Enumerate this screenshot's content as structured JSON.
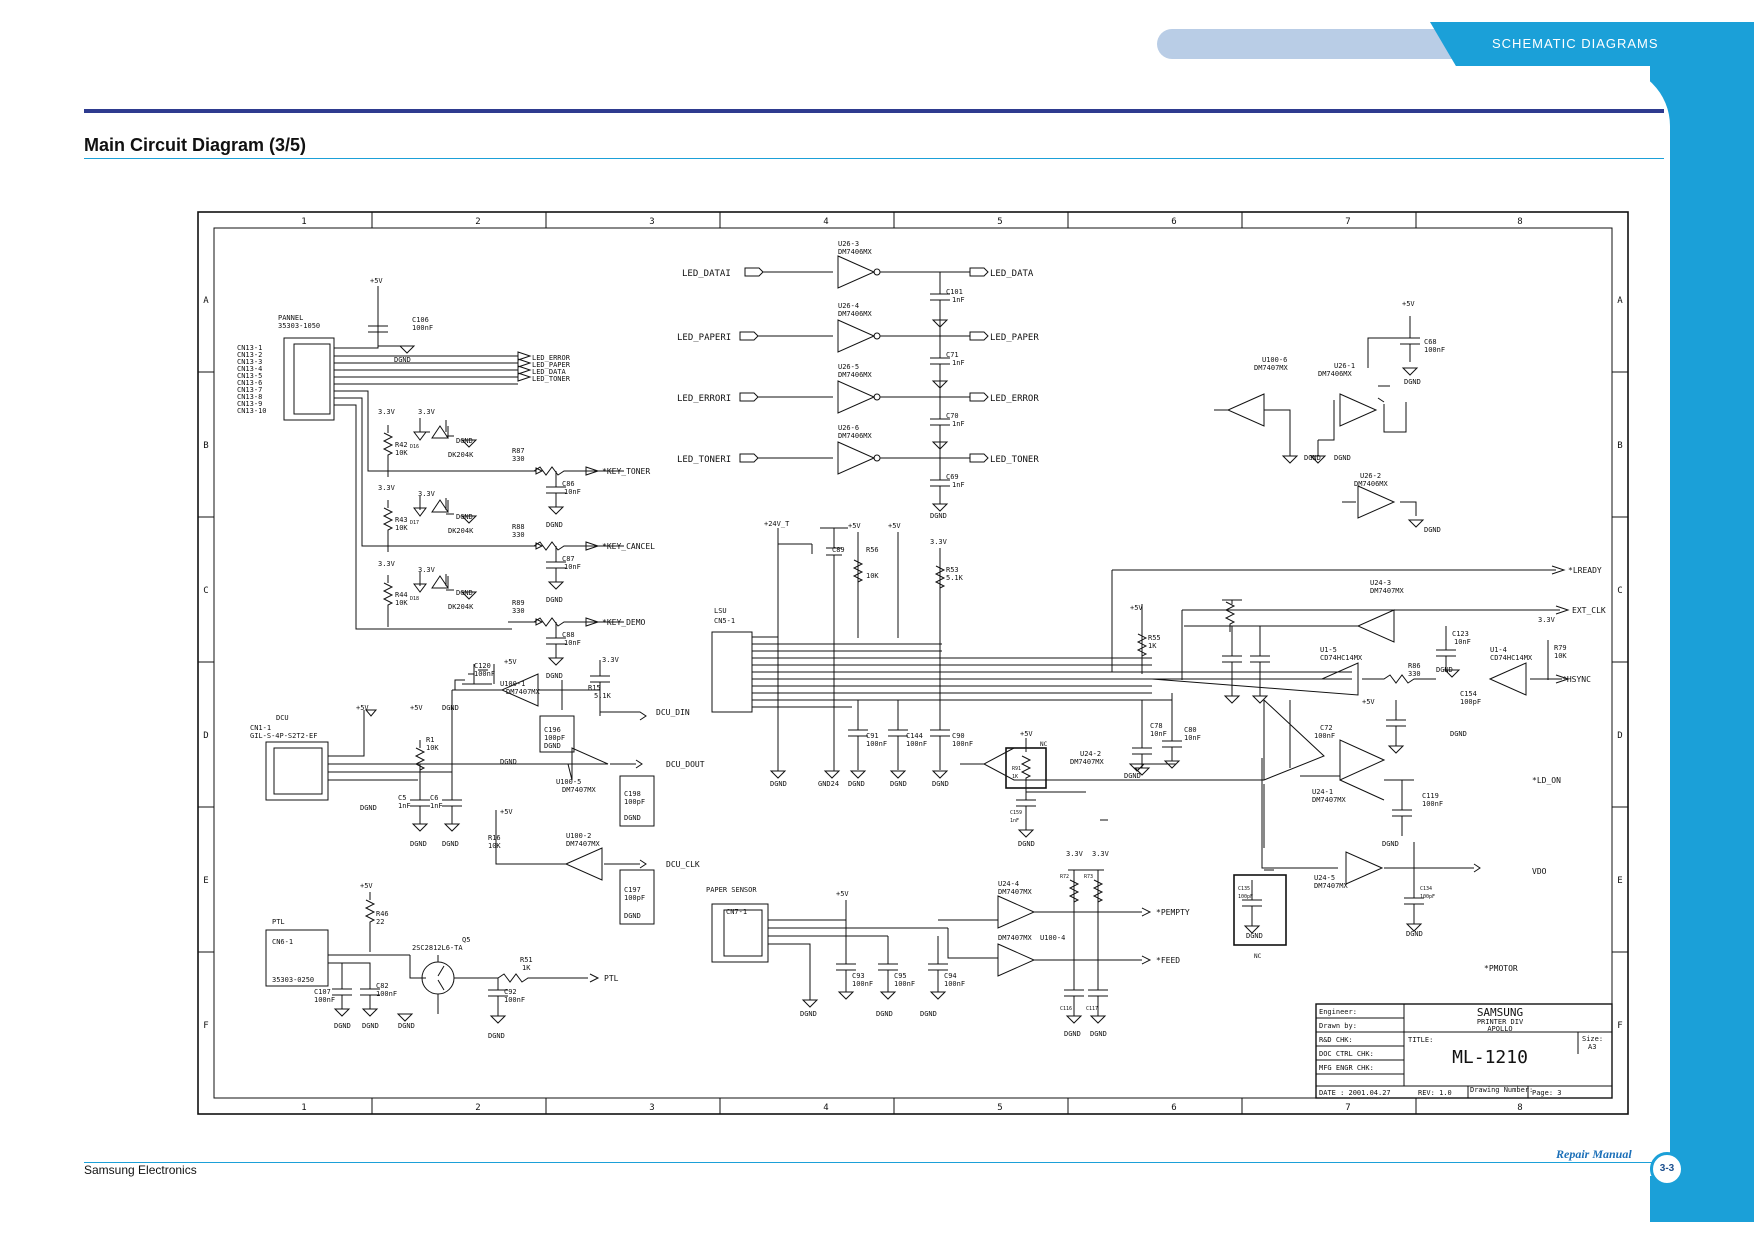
{
  "header": {
    "section_label": "SCHEMATIC DIAGRAMS"
  },
  "page": {
    "title": "Main Circuit Diagram (3/5)",
    "footer_left": "Samsung Electronics",
    "footer_right": "Repair Manual",
    "page_number": "3-3"
  },
  "grid": {
    "columns": [
      "1",
      "2",
      "3",
      "4",
      "5",
      "6",
      "7",
      "8"
    ],
    "rows": [
      "A",
      "B",
      "C",
      "D",
      "E",
      "F"
    ]
  },
  "title_block": {
    "engineer": "Engineer:",
    "drawn_by": "Drawn by:",
    "rnd_chk": "R&D CHK:",
    "doc_ctrl": "DOC CTRL CHK:",
    "mfg_engr": "MFG ENGR CHK:",
    "date": "DATE : 2001.04.27",
    "rev": "REV: 1.0",
    "drawing_number": "Drawing Number:",
    "page": "Page: 3",
    "company": "SAMSUNG",
    "division": "PRINTER DIV",
    "project": "APOLLO",
    "title_label": "TITLE:",
    "model": "ML-1210",
    "size_label": "Size:",
    "size": "A3"
  },
  "labels": {
    "led_data_i": "LED_DATAI",
    "led_data": "LED_DATA",
    "led_paper_i": "LED_PAPERI",
    "led_paper": "LED_PAPER",
    "led_error_i": "LED_ERRORI",
    "led_error": "LED_ERROR",
    "led_toner_i": "LED_TONERI",
    "led_toner": "LED_TONER",
    "led_error_b": "LED_ERROR",
    "led_paper_b": "LED_PAPER",
    "led_data_b": "LED_DATA",
    "led_toner_b": "LED_TONER",
    "u26_3": "U26-3",
    "u26_4": "U26-4",
    "u26_5": "U26-5",
    "u26_6": "U26-6",
    "dm7406": "DM7406MX",
    "c101": "C101",
    "c71": "C71",
    "c70": "C70",
    "c69": "C69",
    "cap_1nf": "1nF",
    "plus5v": "+5V",
    "v33": "3.3V",
    "dgnd": "DGND",
    "gnd24": "GND24",
    "plus24v": "+24V_T",
    "pannel": "PANNEL",
    "pannel_pn": "35303-1050",
    "c106": "C106",
    "c106v": "100nF",
    "cn13_1": "CN13-1",
    "cn13_2": "CN13-2",
    "cn13_3": "CN13-3",
    "cn13_4": "CN13-4",
    "cn13_5": "CN13-5",
    "cn13_6": "CN13-6",
    "cn13_7": "CN13-7",
    "cn13_8": "CN13-8",
    "cn13_9": "CN13-9",
    "cn13_10": "CN13-10",
    "r42": "R42",
    "r43": "R43",
    "r44": "R44",
    "r10k": "10K",
    "dk204k": "DK204K",
    "d16": "D16",
    "d17": "D17",
    "d18": "D18",
    "r87": "R87",
    "r88": "R88",
    "r89": "R89",
    "r330": "330",
    "c86": "C86",
    "c87": "C87",
    "c88": "C88",
    "c10nf": "10nF",
    "key_toner": "*KEY_TONER",
    "key_cancel": "*KEY_CANCEL",
    "key_demo": "*KEY_DEMO",
    "c120": "C120",
    "c100nf": "100nF",
    "u100_1": "U100-1",
    "dm7407": "DM7407MX",
    "r15": "R15",
    "r15v": "5.1K",
    "dcu_din": "DCU_DIN",
    "dcu_dout": "DCU_DOUT",
    "dcu_clk": "DCU_CLK",
    "dcu": "DCU",
    "cn1_1": "CN1-1",
    "cn1_pn": "GIL-S-4P-S2T2-EF",
    "r1": "R1",
    "r1v": "10K",
    "c5": "C5",
    "c6": "C6",
    "u100_5": "U100-5",
    "u100_2": "U100-2",
    "r16": "R16",
    "r16v": "10K",
    "c196": "C196",
    "c197": "C197",
    "c198": "C198",
    "c100pf": "100pF",
    "ptl_title": "PTL",
    "cn6_1": "CN6-1",
    "cn6_pn": "35303-0250",
    "r46": "R46",
    "r46v": "22",
    "q5": "Q5",
    "q5_pn": "2SC2812L6-TA",
    "r51": "R51",
    "r51v": "1K",
    "ptl": "PTL",
    "c107": "C107",
    "c82": "C82",
    "c92": "C92",
    "lsu": "LSU",
    "cn5_1": "CN5-1",
    "c89": "C89",
    "r56": "R56",
    "r56v": "10K",
    "r53": "R53",
    "r53v": "5.1K",
    "c91": "C91",
    "c144": "C144",
    "c90": "C90",
    "paper_sensor": "PAPER SENSOR",
    "cn7_1": "CN7-1",
    "c93": "C93",
    "c95": "C95",
    "c94": "C94",
    "u24_4": "U24-4",
    "u100_4": "U100-4",
    "pempty": "*PEMPTY",
    "feed": "*FEED",
    "r72": "R72",
    "r73": "R73",
    "r1k": "1K",
    "c116": "C116",
    "c117": "C117",
    "r91": "R91",
    "r91v": "1K",
    "nc": "NC",
    "c159": "C159",
    "c159v": "1nF",
    "r55": "R55",
    "r55v": "1K",
    "c78": "C78",
    "c80": "C80",
    "u24_2": "U24-2",
    "u100_6": "U100-6",
    "u26_1": "U26-1",
    "u26_2": "U26-2",
    "c68": "C68",
    "c68v": "100nF",
    "lready": "*LREADY",
    "ext_clk": "EXT_CLK",
    "hsync": "*HSYNC",
    "ld_on": "*LD_ON",
    "vdo": "VDO",
    "pmotor": "*PMOTOR",
    "u24_3": "U24-3",
    "c123": "C123",
    "u1_5": "U1-5",
    "cd74hc14": "CD74HC14MX",
    "r86": "R86",
    "r86v": "330",
    "u1_4": "U1-4",
    "r79": "R79",
    "r79v": "10K",
    "c154": "C154",
    "c72": "C72",
    "u24_1": "U24-1",
    "c119": "C119",
    "u24_5": "U24-5",
    "c134": "C134",
    "c135": "C135"
  }
}
